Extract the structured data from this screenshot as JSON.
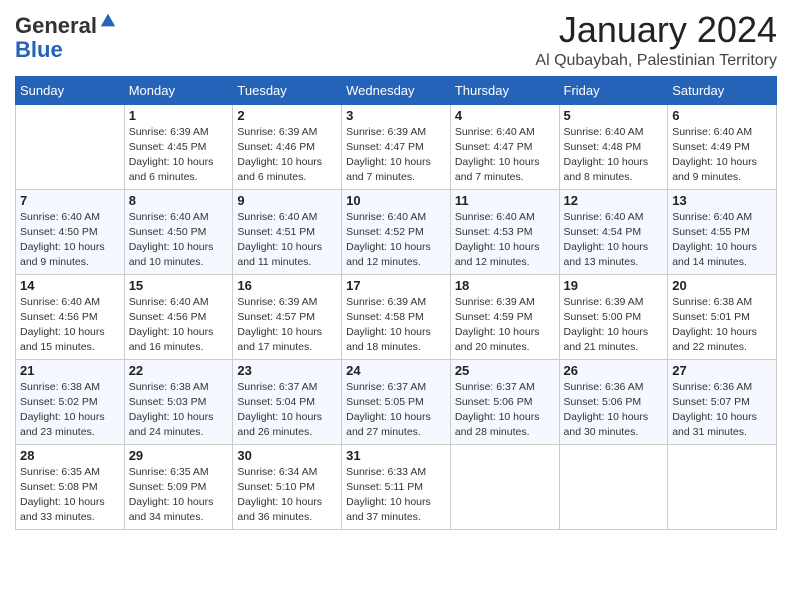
{
  "header": {
    "logo_general": "General",
    "logo_blue": "Blue",
    "month_title": "January 2024",
    "subtitle": "Al Qubaybah, Palestinian Territory"
  },
  "columns": [
    "Sunday",
    "Monday",
    "Tuesday",
    "Wednesday",
    "Thursday",
    "Friday",
    "Saturday"
  ],
  "weeks": [
    [
      {
        "num": "",
        "sunrise": "",
        "sunset": "",
        "daylight": ""
      },
      {
        "num": "1",
        "sunrise": "Sunrise: 6:39 AM",
        "sunset": "Sunset: 4:45 PM",
        "daylight": "Daylight: 10 hours and 6 minutes."
      },
      {
        "num": "2",
        "sunrise": "Sunrise: 6:39 AM",
        "sunset": "Sunset: 4:46 PM",
        "daylight": "Daylight: 10 hours and 6 minutes."
      },
      {
        "num": "3",
        "sunrise": "Sunrise: 6:39 AM",
        "sunset": "Sunset: 4:47 PM",
        "daylight": "Daylight: 10 hours and 7 minutes."
      },
      {
        "num": "4",
        "sunrise": "Sunrise: 6:40 AM",
        "sunset": "Sunset: 4:47 PM",
        "daylight": "Daylight: 10 hours and 7 minutes."
      },
      {
        "num": "5",
        "sunrise": "Sunrise: 6:40 AM",
        "sunset": "Sunset: 4:48 PM",
        "daylight": "Daylight: 10 hours and 8 minutes."
      },
      {
        "num": "6",
        "sunrise": "Sunrise: 6:40 AM",
        "sunset": "Sunset: 4:49 PM",
        "daylight": "Daylight: 10 hours and 9 minutes."
      }
    ],
    [
      {
        "num": "7",
        "sunrise": "Sunrise: 6:40 AM",
        "sunset": "Sunset: 4:50 PM",
        "daylight": "Daylight: 10 hours and 9 minutes."
      },
      {
        "num": "8",
        "sunrise": "Sunrise: 6:40 AM",
        "sunset": "Sunset: 4:50 PM",
        "daylight": "Daylight: 10 hours and 10 minutes."
      },
      {
        "num": "9",
        "sunrise": "Sunrise: 6:40 AM",
        "sunset": "Sunset: 4:51 PM",
        "daylight": "Daylight: 10 hours and 11 minutes."
      },
      {
        "num": "10",
        "sunrise": "Sunrise: 6:40 AM",
        "sunset": "Sunset: 4:52 PM",
        "daylight": "Daylight: 10 hours and 12 minutes."
      },
      {
        "num": "11",
        "sunrise": "Sunrise: 6:40 AM",
        "sunset": "Sunset: 4:53 PM",
        "daylight": "Daylight: 10 hours and 12 minutes."
      },
      {
        "num": "12",
        "sunrise": "Sunrise: 6:40 AM",
        "sunset": "Sunset: 4:54 PM",
        "daylight": "Daylight: 10 hours and 13 minutes."
      },
      {
        "num": "13",
        "sunrise": "Sunrise: 6:40 AM",
        "sunset": "Sunset: 4:55 PM",
        "daylight": "Daylight: 10 hours and 14 minutes."
      }
    ],
    [
      {
        "num": "14",
        "sunrise": "Sunrise: 6:40 AM",
        "sunset": "Sunset: 4:56 PM",
        "daylight": "Daylight: 10 hours and 15 minutes."
      },
      {
        "num": "15",
        "sunrise": "Sunrise: 6:40 AM",
        "sunset": "Sunset: 4:56 PM",
        "daylight": "Daylight: 10 hours and 16 minutes."
      },
      {
        "num": "16",
        "sunrise": "Sunrise: 6:39 AM",
        "sunset": "Sunset: 4:57 PM",
        "daylight": "Daylight: 10 hours and 17 minutes."
      },
      {
        "num": "17",
        "sunrise": "Sunrise: 6:39 AM",
        "sunset": "Sunset: 4:58 PM",
        "daylight": "Daylight: 10 hours and 18 minutes."
      },
      {
        "num": "18",
        "sunrise": "Sunrise: 6:39 AM",
        "sunset": "Sunset: 4:59 PM",
        "daylight": "Daylight: 10 hours and 20 minutes."
      },
      {
        "num": "19",
        "sunrise": "Sunrise: 6:39 AM",
        "sunset": "Sunset: 5:00 PM",
        "daylight": "Daylight: 10 hours and 21 minutes."
      },
      {
        "num": "20",
        "sunrise": "Sunrise: 6:38 AM",
        "sunset": "Sunset: 5:01 PM",
        "daylight": "Daylight: 10 hours and 22 minutes."
      }
    ],
    [
      {
        "num": "21",
        "sunrise": "Sunrise: 6:38 AM",
        "sunset": "Sunset: 5:02 PM",
        "daylight": "Daylight: 10 hours and 23 minutes."
      },
      {
        "num": "22",
        "sunrise": "Sunrise: 6:38 AM",
        "sunset": "Sunset: 5:03 PM",
        "daylight": "Daylight: 10 hours and 24 minutes."
      },
      {
        "num": "23",
        "sunrise": "Sunrise: 6:37 AM",
        "sunset": "Sunset: 5:04 PM",
        "daylight": "Daylight: 10 hours and 26 minutes."
      },
      {
        "num": "24",
        "sunrise": "Sunrise: 6:37 AM",
        "sunset": "Sunset: 5:05 PM",
        "daylight": "Daylight: 10 hours and 27 minutes."
      },
      {
        "num": "25",
        "sunrise": "Sunrise: 6:37 AM",
        "sunset": "Sunset: 5:06 PM",
        "daylight": "Daylight: 10 hours and 28 minutes."
      },
      {
        "num": "26",
        "sunrise": "Sunrise: 6:36 AM",
        "sunset": "Sunset: 5:06 PM",
        "daylight": "Daylight: 10 hours and 30 minutes."
      },
      {
        "num": "27",
        "sunrise": "Sunrise: 6:36 AM",
        "sunset": "Sunset: 5:07 PM",
        "daylight": "Daylight: 10 hours and 31 minutes."
      }
    ],
    [
      {
        "num": "28",
        "sunrise": "Sunrise: 6:35 AM",
        "sunset": "Sunset: 5:08 PM",
        "daylight": "Daylight: 10 hours and 33 minutes."
      },
      {
        "num": "29",
        "sunrise": "Sunrise: 6:35 AM",
        "sunset": "Sunset: 5:09 PM",
        "daylight": "Daylight: 10 hours and 34 minutes."
      },
      {
        "num": "30",
        "sunrise": "Sunrise: 6:34 AM",
        "sunset": "Sunset: 5:10 PM",
        "daylight": "Daylight: 10 hours and 36 minutes."
      },
      {
        "num": "31",
        "sunrise": "Sunrise: 6:33 AM",
        "sunset": "Sunset: 5:11 PM",
        "daylight": "Daylight: 10 hours and 37 minutes."
      },
      {
        "num": "",
        "sunrise": "",
        "sunset": "",
        "daylight": ""
      },
      {
        "num": "",
        "sunrise": "",
        "sunset": "",
        "daylight": ""
      },
      {
        "num": "",
        "sunrise": "",
        "sunset": "",
        "daylight": ""
      }
    ]
  ]
}
